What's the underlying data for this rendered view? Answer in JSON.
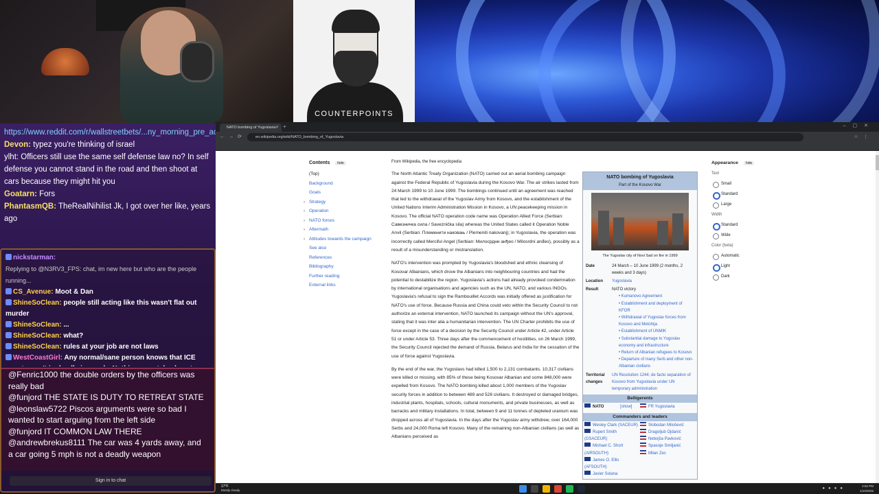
{
  "stream": {
    "overlay_label": "COUNTERPOINTS"
  },
  "chat_upper": [
    {
      "user": "",
      "text": "https://www.reddit.com/r/wallstreetbets/...ny_morning_pre_action_for_us_equities/",
      "link": true
    },
    {
      "user": "Devon:",
      "text": " typez you're thinking of israel"
    },
    {
      "user": "",
      "text": "ylht: Officers still use the same self defense law no? In self defense you cannot stand in the road and then shoot at cars because they might hit you"
    },
    {
      "user": "Goatarn:",
      "text": " Fors"
    },
    {
      "user": "PhantasmQB:",
      "text": " TheRealNihilist Jk, I got over her like, years ago"
    }
  ],
  "chat_mid": [
    {
      "name": "nickstarman:",
      "cls": "n1",
      "text": ""
    },
    {
      "name": "",
      "cls": "reply",
      "text": "Replying to @N3RV3_FPS: chat, im new here but who are the people running..."
    },
    {
      "name": "CS_Avenue:",
      "cls": "n2",
      "text": " Moot & Dan"
    },
    {
      "name": "ShineSoClean:",
      "cls": "n2",
      "text": " people still acting like this wasn't flat out murder"
    },
    {
      "name": "ShineSoClean:",
      "cls": "n2",
      "text": " ..."
    },
    {
      "name": "ShineSoClean:",
      "cls": "n2",
      "text": " what?"
    },
    {
      "name": "ShineSoClean:",
      "cls": "n2",
      "text": " rules at your job are not laws"
    },
    {
      "name": "WestCoastGirl:",
      "cls": "n3",
      "text": " Any normal/sane person knows that ICE agent wasn't in deadly jeopardy. Nothing remotely close to warrant execution in the face"
    }
  ],
  "chat_lower": [
    "@Fenric1000 the double orders by the officers was really bad",
    "@funjord THE STATE IS DUTY TO RETREAT STATE",
    "@leonslaw5722 Piscos arguments were so bad I wanted to start arguing from the left side",
    "@funjord IT COMMON LAW THERE",
    "@andrewbrekus8111 The car was 4 yards away, and a car going 5 mph is not a deadly weapon"
  ],
  "chat_signin": "Sign in to chat",
  "browser": {
    "tab_title": "NATO bombing of Yugoslavia",
    "url": "en.wikipedia.org/wiki/NATO_bombing_of_Yugoslavia"
  },
  "toc": {
    "title": "Contents",
    "hide": "hide",
    "items": [
      "(Top)",
      "Background",
      "Goals",
      "Strategy",
      "Operation",
      "NATO forces",
      "Aftermath",
      "Attitudes towards the campaign",
      "See also",
      "References",
      "Bibliography",
      "Further reading",
      "External links"
    ]
  },
  "article": {
    "from": "From Wikipedia, the free encyclopedia",
    "p1": "The North Atlantic Treaty Organization (NATO) carried out an aerial bombing campaign against the Federal Republic of Yugoslavia during the Kosovo War. The air strikes lasted from 24 March 1999 to 10 June 1999. The bombings continued until an agreement was reached that led to the withdrawal of the Yugoslav Army from Kosovo, and the establishment of the United Nations Interim Administration Mission in Kosovo, a UN peacekeeping mission in Kosovo. The official NATO operation code name was Operation Allied Force (Serbian: Савезничка сила / Saveznička sila) whereas the United States called it Operation Noble Anvil (Serbian: Племенити наковањ / Plemeniti nakovanj); in Yugoslavia, the operation was incorrectly called Merciful Angel (Serbian: Милосрдни анђео / Milosrdni anđeo), possibly as a result of a misunderstanding or mistranslation.",
    "p2": "NATO's intervention was prompted by Yugoslavia's bloodshed and ethnic cleansing of Kosovar Albanians, which drove the Albanians into neighbouring countries and had the potential to destabilize the region. Yugoslavia's actions had already provoked condemnation by international organisations and agencies such as the UN, NATO, and various INGOs. Yugoslavia's refusal to sign the Rambouillet Accords was initially offered as justification for NATO's use of force. Because Russia and China could veto within the Security Council to not authorize an external intervention, NATO launched its campaign without the UN's approval, stating that it was inter alia a humanitarian intervention. The UN Charter prohibits the use of force except in the case of a decision by the Security Council under Article 42, under Article 51 or under Article 53. Three days after the commencement of hostilities, on 26 March 1999, the Security Council rejected the demand of Russia, Belarus and India for the cessation of the use of force against Yugoslavia.",
    "p3": "By the end of the war, the Yugoslavs had killed 1,500 to 2,131 combatants. 10,317 civilians were killed or missing, with 85% of these being Kosovar Albanian and some 848,000 were expelled from Kosovo. The NATO bombing killed about 1,000 members of the Yugoslav security forces in addition to between 489 and 528 civilians. It destroyed or damaged bridges, industrial plants, hospitals, schools, cultural monuments, and private businesses, as well as barracks and military installations. In total, between 9 and 11 tonnes of depleted uranium was dropped across all of Yugoslavia. In the days after the Yugoslav army withdrew, over 164,000 Serbs and 24,000 Roma left Kosovo. Many of the remaining non-Albanian civilians (as well as Albanians perceived as"
  },
  "infobox": {
    "title": "NATO bombing of Yugoslavia",
    "subtitle": "Part of the Kosovo War",
    "caption": "The Yugoslav city of Novi Sad on fire in 1999",
    "date_label": "Date",
    "date": "24 March – 10 June 1999 (2 months, 2 weeks and 3 days)",
    "location_label": "Location",
    "location": "Yugoslavia",
    "result_label": "Result",
    "result": "NATO victory",
    "result_items": [
      "Kumanovo Agreement",
      "Establishment and deployment of KFOR",
      "Withdrawal of Yugoslav forces from Kosovo and Metohija",
      "Establishment of UNMIK",
      "Substantial damage to Yugoslav economy and infrastructure",
      "Return of Albanian refugees to Kosovo",
      "Departure of many Serb and other non-Albanian civilians"
    ],
    "territorial_label": "Territorial changes",
    "territorial": "UN Resolution 1244; de facto separation of Kosovo from Yugoslavia under UN temporary administration",
    "belligerents": "Belligerents",
    "bel_left": "NATO",
    "bel_show": "[show]",
    "bel_right": "FR Yugoslavia",
    "commanders": "Commanders and leaders",
    "cmd_left": [
      "Wesley Clark (SACEUR)",
      "Rupert Smith (DSACEUR)",
      "Michael C. Short (AIRSOUTH)",
      "James O. Ellis (AFSOUTH)",
      "Javier Solana"
    ],
    "cmd_right": [
      "Slobodan Milošević",
      "Dragoljub Ojdanić",
      "Nebojša Pavković",
      "Spasoje Smiljanić",
      "Milan Zec"
    ]
  },
  "appearance": {
    "title": "Appearance",
    "hide": "hide",
    "text_label": "Text",
    "text_opts": [
      "Small",
      "Standard",
      "Large"
    ],
    "width_label": "Width",
    "width_opts": [
      "Standard",
      "Wide"
    ],
    "color_label": "Color (beta)",
    "color_opts": [
      "Automatic",
      "Light",
      "Dark"
    ]
  },
  "taskbar": {
    "temp": "17°F",
    "weather": "Mostly cloudy",
    "time": "2:52 PM",
    "date": "1/10/2026"
  }
}
